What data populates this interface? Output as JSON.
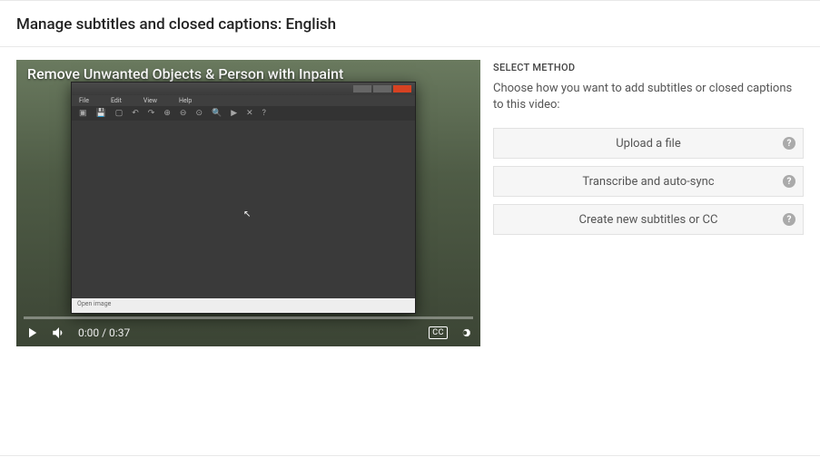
{
  "header": {
    "title": "Manage subtitles and closed captions: English"
  },
  "video": {
    "overlay_title": "Remove Unwanted Objects & Person with Inpaint",
    "app_menu": {
      "file": "File",
      "edit": "Edit",
      "view": "View",
      "help": "Help"
    },
    "app_status": "Open  image",
    "time_current": "0:00",
    "time_separator": " / ",
    "time_total": "0:37",
    "cc_label": "CC"
  },
  "method": {
    "heading": "SELECT METHOD",
    "description": "Choose how you want to add subtitles or closed captions to this video:",
    "options": [
      {
        "label": "Upload a file"
      },
      {
        "label": "Transcribe and auto-sync"
      },
      {
        "label": "Create new subtitles or CC"
      }
    ],
    "help_glyph": "?"
  }
}
